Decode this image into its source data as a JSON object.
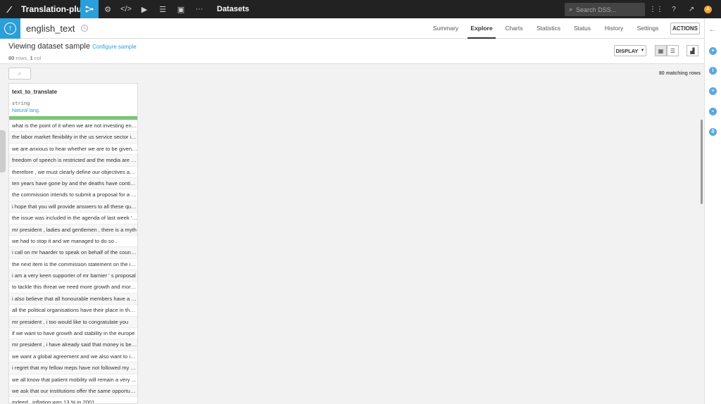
{
  "app": {
    "project_name": "Translation-plugin",
    "context": "Datasets",
    "search_placeholder": "Search DSS...",
    "user_initial": "A"
  },
  "dataset": {
    "name": "english_text",
    "tabs": [
      "Summary",
      "Explore",
      "Charts",
      "Statistics",
      "Status",
      "History",
      "Settings"
    ],
    "active_tab": "Explore",
    "actions_label": "ACTIONS"
  },
  "sample": {
    "title": "Viewing dataset sample",
    "configure_label": "Configure sample",
    "rows_count": "80",
    "rows_label": "rows,",
    "cols_count": "1",
    "cols_label": "col",
    "display_label": "DISPLAY",
    "matching_rows": "80 matching rows"
  },
  "table": {
    "column": {
      "name": "text_to_translate",
      "type": "string",
      "meaning": "Natural lang.",
      "valid_color": "#7cc576"
    },
    "rows": [
      "what is the point of it when we are not investing enough in research and innovation ?",
      "the labor market flexibility in the us service sector is far greater",
      "we are anxious to hear whether we are to be given the opportunity",
      "freedom of speech is restricted and the media are controlled",
      "therefore , we must clearly define our objectives and priorities",
      "ten years have gone by and the deaths have continued",
      "the commission intends to submit a proposal for a directive",
      "i hope that you will provide answers to all these questions",
      "the issue was included in the agenda of last week ' s meeting",
      "mr president , ladies and gentlemen , there is a myth",
      "we had to stop it and we managed to do so .",
      "i call on mr haarder to speak on behalf of the council .",
      "the next item is the commission statement on the issue",
      "i am a very keen supporter of mr barnier ' s proposal",
      "to tackle this threat we need more growth and more jobs",
      "i also believe that all honourable members have a duty",
      "all the political organisations have their place in the debate",
      "mr president , i too would like to congratulate you",
      "if we want to have growth and stability in the europe",
      "mr president , i have already said that money is being wasted",
      "we want a global agreement and we also want to include",
      "i regret that my fellow meps have not followed my advice",
      "we all know that patient mobility will remain a very small",
      "we ask that our institutions offer the same opportunities",
      "indeed , inflation was 13 % in 2001 ."
    ]
  },
  "colors": {
    "topbar": "#222222",
    "accent": "#2b9fd9",
    "avatar": "#f0a030"
  }
}
